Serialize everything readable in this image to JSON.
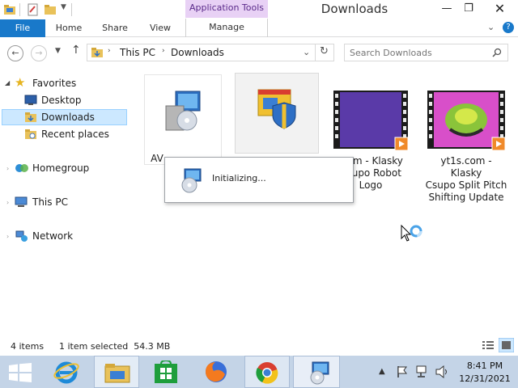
{
  "titlebar": {
    "context_tab": "Application Tools",
    "title": "Downloads",
    "minimize": "—",
    "maximize": "❐",
    "close": "✕"
  },
  "ribbon": {
    "tabs": [
      {
        "label": "File"
      },
      {
        "label": "Home"
      },
      {
        "label": "Share"
      },
      {
        "label": "View"
      },
      {
        "label": "Manage"
      }
    ]
  },
  "address": {
    "segments": [
      "This PC",
      "Downloads"
    ],
    "search_placeholder": "Search Downloads"
  },
  "nav": {
    "items": [
      {
        "label": "Favorites"
      },
      {
        "label": "Desktop"
      },
      {
        "label": "Downloads"
      },
      {
        "label": "Recent places"
      },
      {
        "label": "Homegroup"
      },
      {
        "label": "This PC"
      },
      {
        "label": "Network"
      }
    ]
  },
  "files": [
    {
      "label": "AV",
      "icon": "installer-icon"
    },
    {
      "label": "",
      "icon": "shield-window-icon"
    },
    {
      "label_lines": [
        ".com - Klasky",
        "Csupo Robot",
        "Logo"
      ],
      "icon": "video-thumbnail"
    },
    {
      "label_lines": [
        "yt1s.com - Klasky",
        "Csupo Split Pitch",
        "Shifting Update"
      ],
      "icon": "video-thumbnail"
    }
  ],
  "dialog": {
    "text": "Initializing..."
  },
  "status": {
    "items_count": "4 items",
    "selection": "1 item selected  54.3 MB"
  },
  "clock": {
    "time": "8:41 PM",
    "date": "12/31/2021"
  },
  "colors": {
    "accent": "#1979ca",
    "context_tab": "#e8d1f5",
    "taskbar": "#c4d4e7",
    "selection": "#cce8ff"
  }
}
